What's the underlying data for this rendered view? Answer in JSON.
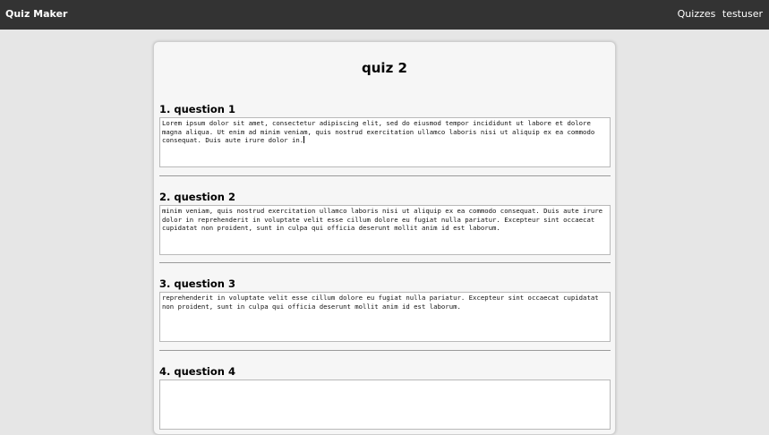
{
  "app": {
    "brand": "Quiz Maker",
    "nav_quizzes": "Quizzes",
    "nav_user": "testuser"
  },
  "quiz": {
    "title": "quiz 2",
    "questions": [
      {
        "label": "1. question 1",
        "answer": "Lorem ipsum dolor sit amet, consectetur adipiscing elit, sed do eiusmod tempor incididunt ut labore et dolore magna aliqua. Ut enim ad minim veniam, quis nostrud exercitation ullamco laboris nisi ut aliquip ex ea commodo consequat. Duis aute irure dolor in."
      },
      {
        "label": "2. question 2",
        "answer": "minim veniam, quis nostrud exercitation ullamco laboris nisi ut aliquip ex ea commodo consequat. Duis aute irure dolor in reprehenderit in voluptate velit esse cillum dolore eu fugiat nulla pariatur. Excepteur sint occaecat cupidatat non proident, sunt in culpa qui officia deserunt mollit anim id est laborum."
      },
      {
        "label": "3. question 3",
        "answer": "reprehenderit in voluptate velit esse cillum dolore eu fugiat nulla pariatur. Excepteur sint occaecat cupidatat non proident, sunt in culpa qui officia deserunt mollit anim id est laborum."
      },
      {
        "label": "4. question 4",
        "answer": ""
      }
    ]
  }
}
